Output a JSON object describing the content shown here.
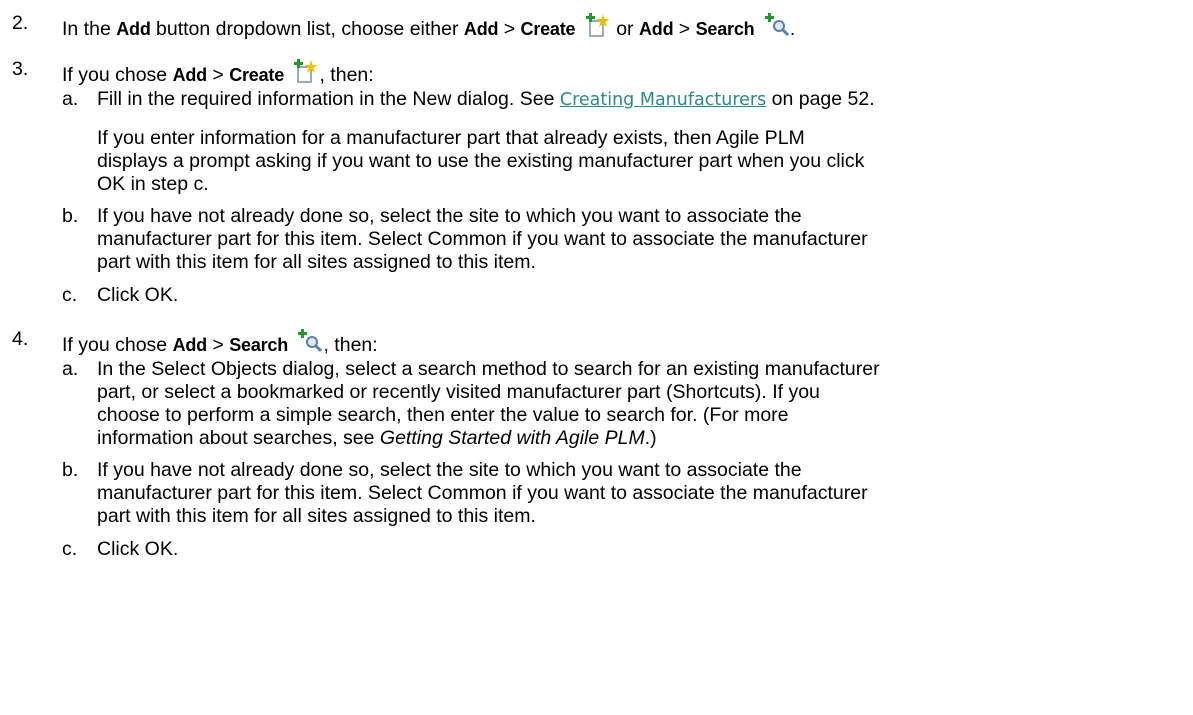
{
  "steps": {
    "s2": {
      "number": "2.",
      "t1": "In the ",
      "b1": "Add",
      "t2": " button dropdown list, choose either ",
      "b2": "Add",
      "t3": " > ",
      "b3": "Create",
      "t4": " or ",
      "b4": "Add",
      "t5": " > ",
      "b5": "Search",
      "t6": "."
    },
    "s3": {
      "number": "3.",
      "t1": "If you chose ",
      "b1": "Add",
      "t2": " > ",
      "b2": "Create",
      "t3": ", then:",
      "a": {
        "letter": "a.",
        "t1": "Fill in the required information in the New dialog. See ",
        "link": "Creating Manufacturers",
        "t2": " on page 52.",
        "note_line1": "If you enter information for a manufacturer part that already exists, then Agile PLM",
        "note_line2": "displays a prompt asking if you want to use the existing manufacturer part when you click",
        "note_line3": "OK in step c."
      },
      "b": {
        "letter": "b.",
        "line1": "If you have not already done so, select the site to which you want to associate the",
        "line2": "manufacturer part for this item. Select Common if you want to associate the manufacturer",
        "line3": "part with this item for all sites assigned to this item."
      },
      "c": {
        "letter": "c.",
        "text": "Click OK."
      }
    },
    "s4": {
      "number": "4.",
      "t1": "If you chose ",
      "b1": "Add",
      "t2": " > ",
      "b2": "Search",
      "t3": ", then:",
      "a": {
        "letter": "a.",
        "line1": "In the Select Objects dialog, select a search method to search for an existing manufacturer",
        "line2": "part, or select a bookmarked or recently visited manufacturer part (Shortcuts). If you",
        "line3": "choose to perform a simple search, then enter the value to search for. (For more",
        "line4_t1": "information about searches, see ",
        "line4_italic": "Getting Started with Agile PLM",
        "line4_t2": ".)"
      },
      "b": {
        "letter": "b.",
        "line1": "If you have not already done so, select the site to which you want to associate the",
        "line2": "manufacturer part for this item. Select Common if you want to associate the manufacturer",
        "line3": "part with this item for all sites assigned to this item."
      },
      "c": {
        "letter": "c.",
        "text": "Click OK."
      }
    }
  },
  "icons": {
    "create": "add-create-icon",
    "search": "add-search-icon",
    "colors": {
      "plus": "#1f9a2c",
      "page": "#7a8fa8",
      "star": "#f2c200",
      "lens": "#5b7fae"
    }
  }
}
